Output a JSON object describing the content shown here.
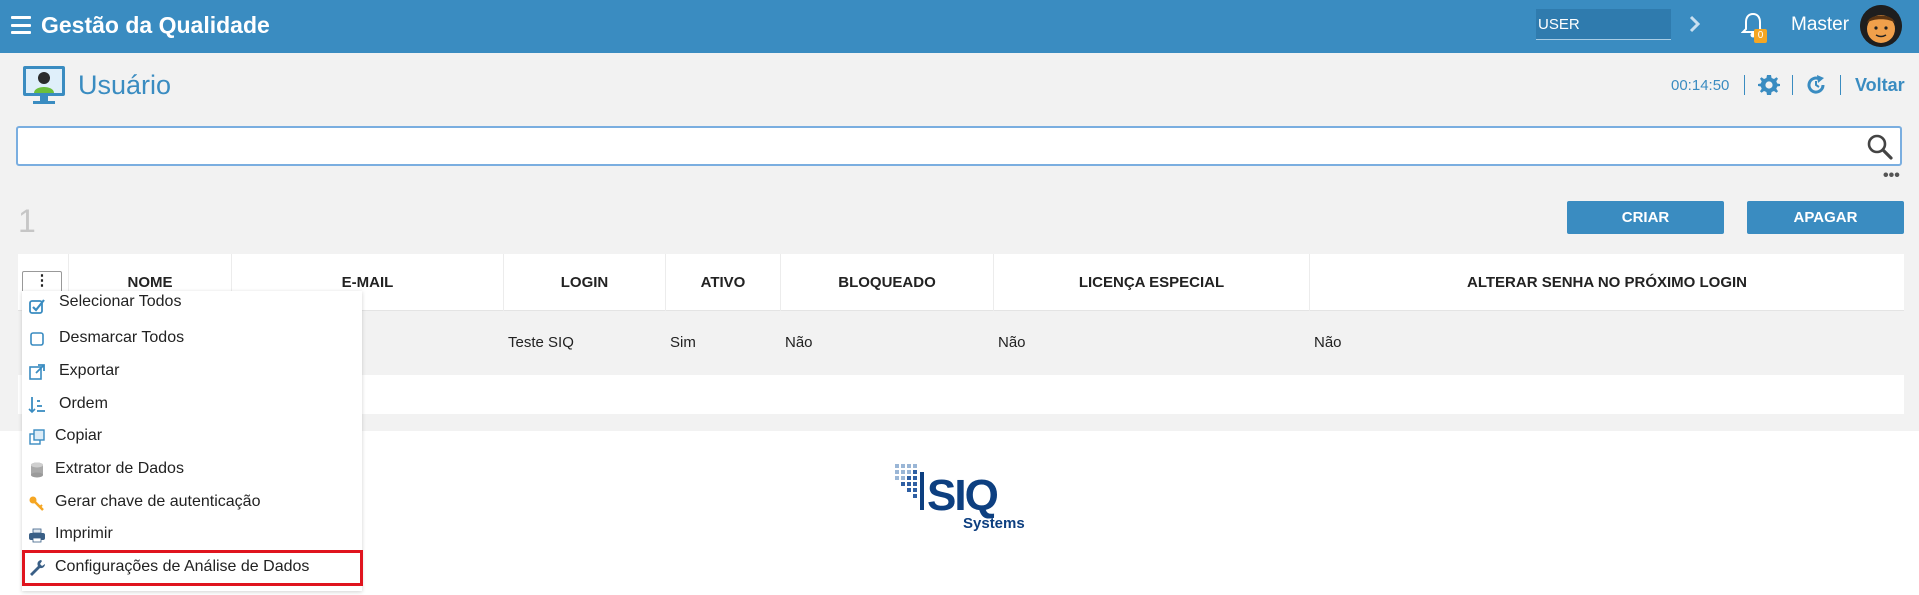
{
  "header": {
    "app_title": "Gestão da Qualidade",
    "user_field_value": "USER",
    "notifications_count": "0",
    "user_name": "Master"
  },
  "page": {
    "title": "Usuário",
    "timer": "00:14:50",
    "back_label": "Voltar"
  },
  "search": {
    "value": "",
    "placeholder": ""
  },
  "list": {
    "count": "1",
    "create_label": "CRIAR",
    "delete_label": "APAGAR"
  },
  "table": {
    "column_menu_label": "⋮",
    "columns": [
      "NOME",
      "E-MAIL",
      "LOGIN",
      "ATIVO",
      "BLOQUEADO",
      "LICENÇA ESPECIAL",
      "ALTERAR SENHA NO PRÓXIMO LOGIN"
    ],
    "rows": [
      {
        "nome": "",
        "email": "",
        "login": "Teste SIQ",
        "ativo": "Sim",
        "bloqueado": "Não",
        "licenca": "Não",
        "alterar_senha": "Não"
      }
    ]
  },
  "context_menu": {
    "items": [
      {
        "label": "Selecionar Todos",
        "icon": "checkbox-checked-icon"
      },
      {
        "label": "Desmarcar Todos",
        "icon": "checkbox-empty-icon"
      },
      {
        "label": "Exportar",
        "icon": "external-link-icon"
      },
      {
        "label": "Ordem",
        "icon": "sort-icon"
      },
      {
        "label": "Copiar",
        "icon": "copy-icon"
      },
      {
        "label": "Extrator de Dados",
        "icon": "database-icon"
      },
      {
        "label": "Gerar chave de autenticação",
        "icon": "key-icon"
      },
      {
        "label": "Imprimir",
        "icon": "printer-icon"
      },
      {
        "label": "Configurações de Análise de Dados",
        "icon": "wrench-icon"
      }
    ]
  },
  "footer": {
    "logo_text": "SIQ",
    "logo_subtext": "Systems"
  },
  "colors": {
    "primary": "#3a8cc1",
    "highlight_border": "#e0141e",
    "badge": "#f5a623"
  }
}
